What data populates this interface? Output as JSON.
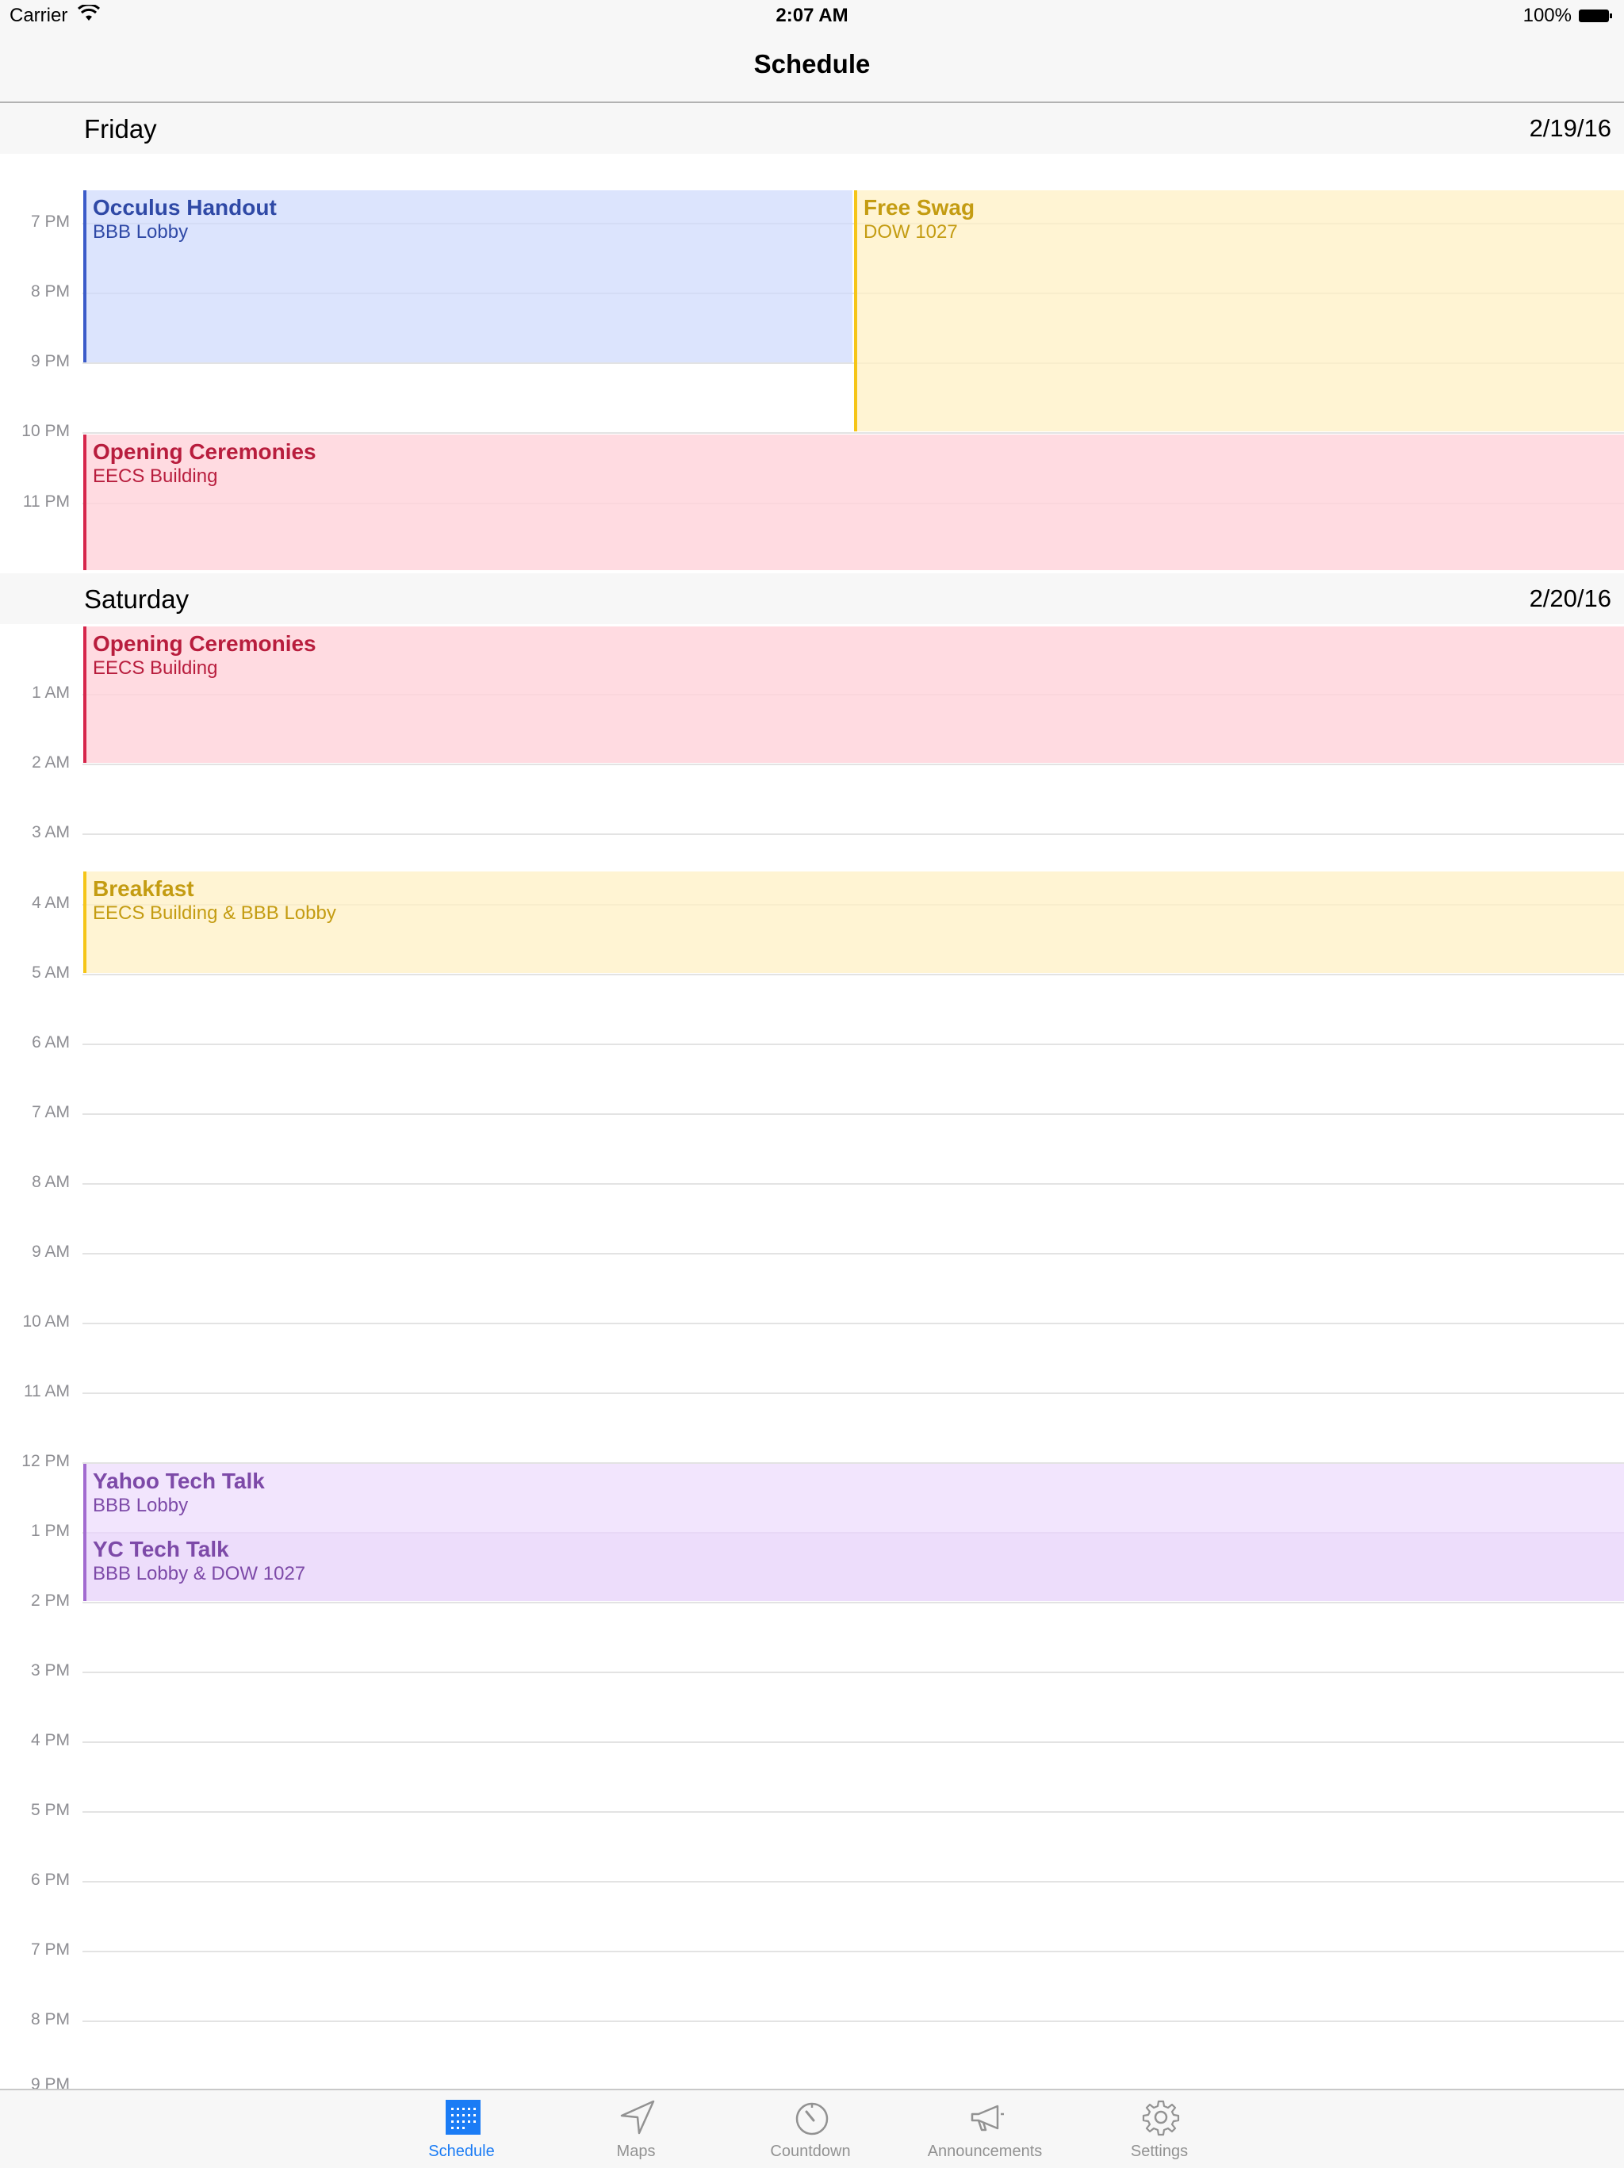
{
  "status_bar": {
    "carrier": "Carrier",
    "time": "2:07 AM",
    "battery": "100%"
  },
  "nav": {
    "title": "Schedule"
  },
  "days": [
    {
      "name": "Friday",
      "date": "2/19/16"
    },
    {
      "name": "Saturday",
      "date": "2/20/16"
    }
  ],
  "hours_friday": [
    "7 PM",
    "8 PM",
    "9 PM",
    "10 PM",
    "11 PM"
  ],
  "hours_saturday": [
    "1 AM",
    "2 AM",
    "3 AM",
    "4 AM",
    "5 AM",
    "6 AM",
    "7 AM",
    "8 AM",
    "9 AM",
    "10 AM",
    "11 AM",
    "12 PM",
    "1 PM",
    "2 PM",
    "3 PM",
    "4 PM",
    "5 PM",
    "6 PM",
    "7 PM",
    "8 PM",
    "9 PM"
  ],
  "events": [
    {
      "title": "Occulus Handout",
      "location": "BBB Lobby",
      "color": "#3b5bc9"
    },
    {
      "title": "Free Swag",
      "location": "DOW 1027",
      "color": "#f5c518"
    },
    {
      "title": "Opening Ceremonies",
      "location": "EECS Building",
      "color": "#d6264b"
    },
    {
      "title": "Opening Ceremonies",
      "location": "EECS Building",
      "color": "#d6264b"
    },
    {
      "title": "Breakfast",
      "location": "EECS Building & BBB Lobby",
      "color": "#f5c518"
    },
    {
      "title": "Yahoo Tech Talk",
      "location": "BBB Lobby",
      "color": "#a26bd0"
    },
    {
      "title": "YC Tech Talk",
      "location": "BBB Lobby & DOW 1027",
      "color": "#a26bd0"
    }
  ],
  "tabs": [
    {
      "label": "Schedule",
      "icon": "calendar-grid-icon",
      "active": true
    },
    {
      "label": "Maps",
      "icon": "location-arrow-icon",
      "active": false
    },
    {
      "label": "Countdown",
      "icon": "timer-icon",
      "active": false
    },
    {
      "label": "Announcements",
      "icon": "megaphone-icon",
      "active": false
    },
    {
      "label": "Settings",
      "icon": "gear-icon",
      "active": false
    }
  ],
  "accent_color": "#1b7cf5"
}
